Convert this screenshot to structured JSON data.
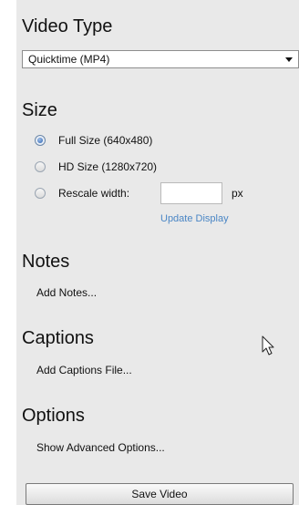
{
  "video_type": {
    "title": "Video Type",
    "selected": "Quicktime (MP4)"
  },
  "size": {
    "title": "Size",
    "options": [
      {
        "label": "Full Size (640x480)",
        "checked": true
      },
      {
        "label": "HD Size (1280x720)",
        "checked": false
      },
      {
        "label": "Rescale width:",
        "checked": false
      }
    ],
    "rescale_value": "",
    "unit": "px",
    "update_link": "Update Display"
  },
  "notes": {
    "title": "Notes",
    "action": "Add Notes..."
  },
  "captions": {
    "title": "Captions",
    "action": "Add Captions File..."
  },
  "options": {
    "title": "Options",
    "action": "Show Advanced Options..."
  },
  "save_button": "Save Video",
  "colors": {
    "panel_bg": "#e9e9e9",
    "link": "#4a86c5"
  },
  "icons": {
    "dropdown": "chevron-down-icon",
    "pointer": "mouse-pointer-icon"
  }
}
